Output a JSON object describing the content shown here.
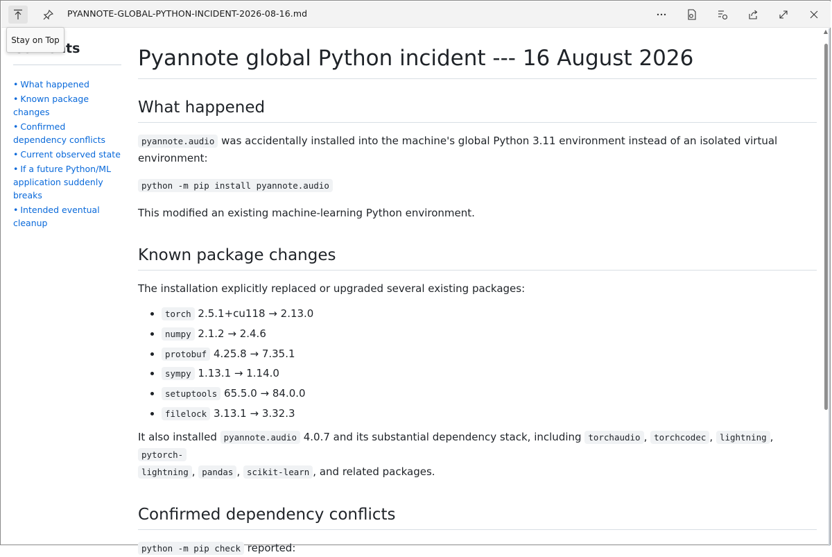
{
  "titlebar": {
    "filename": "PYANNOTE-GLOBAL-PYTHON-INCIDENT-2026-08-16.md",
    "tooltip": "Stay on Top",
    "icons": [
      "stay-on-top-icon",
      "pin-icon",
      "more-icon",
      "read-aloud-icon",
      "search-doc-icon",
      "share-icon",
      "expand-icon",
      "close-icon"
    ]
  },
  "sidebar": {
    "heading": "Contents",
    "items": [
      {
        "label": "What happened"
      },
      {
        "label": "Known package changes"
      },
      {
        "label": "Confirmed dependency conflicts"
      },
      {
        "label": "Current observed state"
      },
      {
        "label": "If a future Python/ML application suddenly breaks"
      },
      {
        "label": "Intended eventual cleanup"
      }
    ]
  },
  "doc": {
    "title": "Pyannote global Python incident --- 16 August 2026",
    "section1": {
      "heading": "What happened",
      "p1_code": "pyannote.audio",
      "p1_text": " was accidentally installed into the machine's global Python 3.11 environment instead of an isolated virtual environment:",
      "cmd": "python -m pip install pyannote.audio",
      "p2": "This modified an existing machine-learning Python environment."
    },
    "section2": {
      "heading": "Known package changes",
      "intro": "The installation explicitly replaced or upgraded several existing packages:",
      "packages": [
        {
          "name": "torch",
          "change": "2.5.1+cu118 → 2.13.0"
        },
        {
          "name": "numpy",
          "change": "2.1.2 → 2.4.6"
        },
        {
          "name": "protobuf",
          "change": "4.25.8 → 7.35.1"
        },
        {
          "name": "sympy",
          "change": "1.13.1 → 1.14.0"
        },
        {
          "name": "setuptools",
          "change": "65.5.0 → 84.0.0"
        },
        {
          "name": "filelock",
          "change": "3.13.1 → 3.32.3"
        }
      ],
      "also_t1": "It also installed ",
      "also_c1": "pyannote.audio",
      "also_t2": " 4.0.7 and its substantial dependency stack, including ",
      "also_c2": "torchaudio",
      "also_t3": ", ",
      "also_c3": "torchcodec",
      "also_t4": ", ",
      "also_c4": "lightning",
      "also_t5": ", ",
      "also_c5a": "pytorch-",
      "also_c5b": "lightning",
      "also_t6": ", ",
      "also_c6": "pandas",
      "also_t7": ", ",
      "also_c7": "scikit-learn",
      "also_t8": ", and related packages."
    },
    "section3": {
      "heading": "Confirmed dependency conflicts",
      "cmd": "python -m pip check",
      "text": " reported:"
    }
  }
}
